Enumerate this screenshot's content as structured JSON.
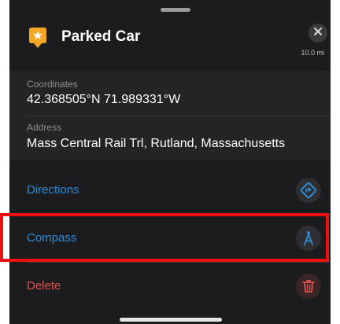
{
  "header": {
    "title": "Parked Car",
    "distance": "10.0 mi",
    "pin_icon": "star-pin-icon",
    "close_icon": "close-icon"
  },
  "info": {
    "coordinates_label": "Coordinates",
    "coordinates_value": "42.368505°N 71.989331°W",
    "address_label": "Address",
    "address_value": "Mass Central Rail Trl, Rutland, Massachusetts"
  },
  "actions": [
    {
      "label": "Directions",
      "icon": "directions-icon",
      "color": "#2d8bd6"
    },
    {
      "label": "Compass",
      "icon": "compass-icon",
      "color": "#2d8bd6"
    },
    {
      "label": "Delete",
      "icon": "trash-icon",
      "color": "#d9534f"
    }
  ],
  "colors": {
    "accent": "#2d8bd6",
    "destructive": "#d9534f",
    "pin": "#f5a623",
    "highlight": "#ee1010"
  }
}
